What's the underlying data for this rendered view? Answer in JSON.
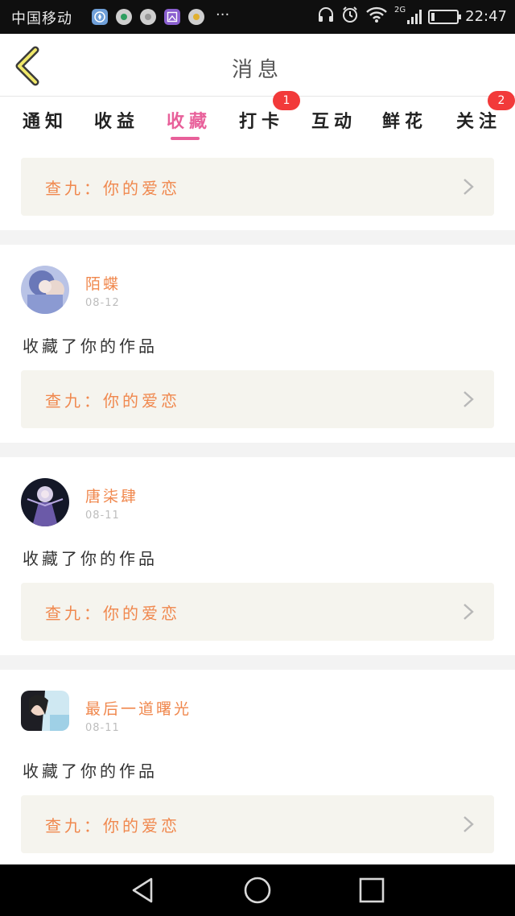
{
  "status_bar": {
    "carrier": "中国移动",
    "network_type": "2G",
    "time": "22:47",
    "more_indicator": "···",
    "notification_icons": [
      "compass-app-icon",
      "hex-app-icon-1",
      "hex-app-icon-2",
      "gallery-app-icon",
      "hex-app-icon-3"
    ]
  },
  "header": {
    "title": "消息",
    "back_icon": "chevron-left-icon"
  },
  "tabs": [
    {
      "label": "通知",
      "active": false,
      "badge": ""
    },
    {
      "label": "收益",
      "active": false,
      "badge": ""
    },
    {
      "label": "收藏",
      "active": true,
      "badge": ""
    },
    {
      "label": "打卡",
      "active": false,
      "badge": "1"
    },
    {
      "label": "互动",
      "active": false,
      "badge": ""
    },
    {
      "label": "鲜花",
      "active": false,
      "badge": ""
    },
    {
      "label": "关注",
      "active": false,
      "badge": "2"
    }
  ],
  "first_item": {
    "work_link": "查九：你的爱恋"
  },
  "items": [
    {
      "name": "陌蝶",
      "date": "08-12",
      "action": "收藏了你的作品",
      "work_link": "查九：你的爱恋"
    },
    {
      "name": "唐柒肆",
      "date": "08-11",
      "action": "收藏了你的作品",
      "work_link": "查九：你的爱恋"
    },
    {
      "name": "最后一道曙光",
      "date": "08-11",
      "action": "收藏了你的作品",
      "work_link": "查九：你的爱恋"
    }
  ],
  "nav_bar": {
    "back_icon": "triangle-back-icon",
    "home_icon": "circle-home-icon",
    "recents_icon": "square-recents-icon"
  },
  "colors": {
    "accent": "#e8609a",
    "username": "#f0884e",
    "badge": "#f23a3a",
    "card_bg": "#f5f4ee"
  }
}
